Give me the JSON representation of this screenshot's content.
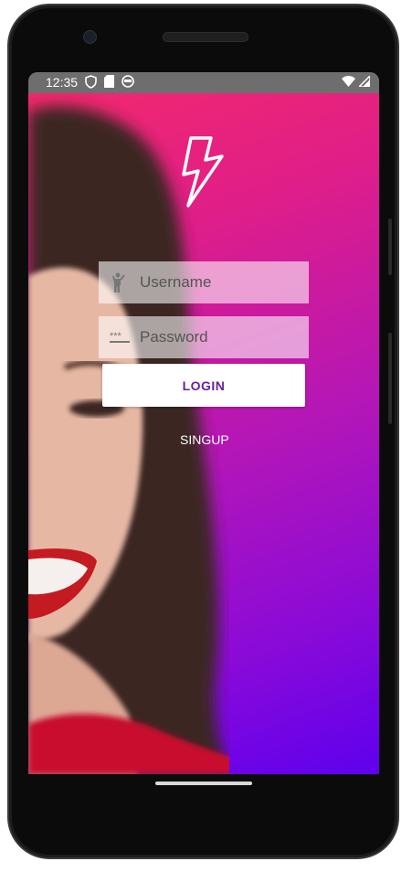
{
  "status_bar": {
    "time": "12:35",
    "left_icons": [
      "shield-icon",
      "sd-card-icon",
      "face-icon"
    ],
    "right_icons": [
      "wifi-icon",
      "signal-icon"
    ]
  },
  "login": {
    "logo_icon": "lightning-bolt-icon",
    "username": {
      "placeholder": "Username",
      "value": "",
      "icon": "person-waving-icon"
    },
    "password": {
      "placeholder": "Password",
      "value": "",
      "icon": "password-dots-icon"
    },
    "login_label": "LOGIN",
    "signup_label": "SINGUP"
  },
  "theme": {
    "gradient_start": "#f42a6a",
    "gradient_end": "#5e00ee",
    "button_text": "#6a1ea0"
  }
}
